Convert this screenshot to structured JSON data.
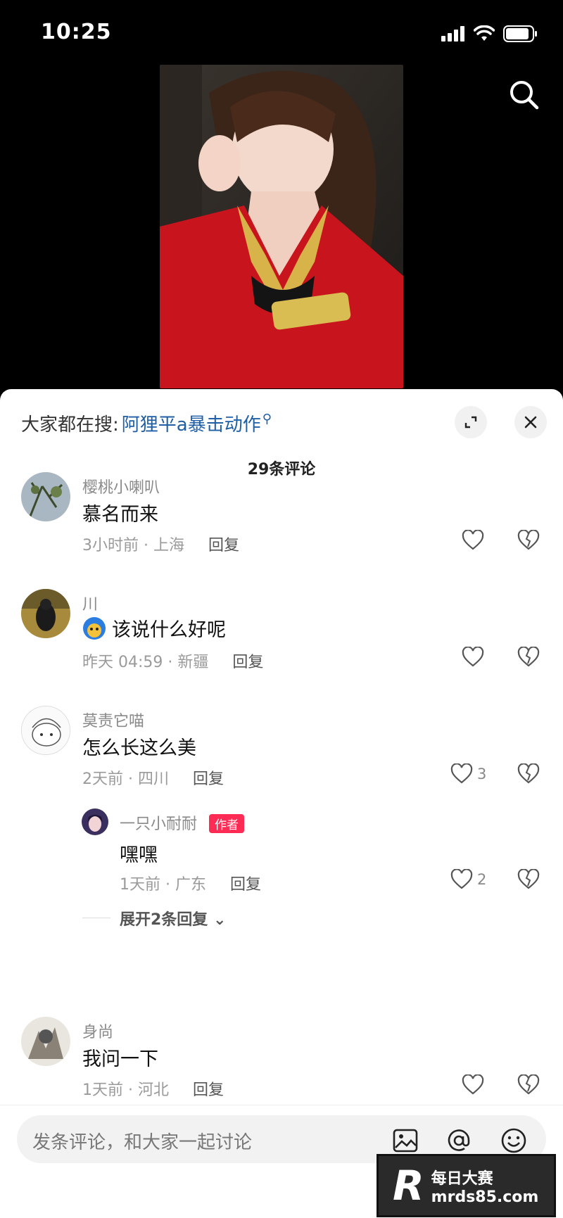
{
  "status": {
    "time": "10:25"
  },
  "sheet": {
    "suggest_prefix": "大家都在搜:",
    "suggest_query": "阿狸平a暴击动作",
    "comment_count": "29条评论"
  },
  "comments": [
    {
      "username": "樱桃小喇叭",
      "text": "慕名而来",
      "meta": "3小时前 · 上海",
      "reply": "回复",
      "likes": ""
    },
    {
      "username": "川",
      "text": "该说什么好呢",
      "meta": "昨天 04:59 · 新疆",
      "reply": "回复",
      "likes": ""
    },
    {
      "username": "莫责它喵",
      "text": "怎么长这么美",
      "meta": "2天前 · 四川",
      "reply": "回复",
      "likes": "3"
    },
    {
      "username": "身尚",
      "text": "我问一下",
      "meta": "1天前 · 河北",
      "reply": "回复",
      "likes": ""
    }
  ],
  "sub_reply": {
    "username": "一只小耐耐",
    "badge": "作者",
    "text": "嘿嘿",
    "meta": "1天前 · 广东",
    "reply": "回复",
    "likes": "2",
    "expand": "展开2条回复"
  },
  "input": {
    "placeholder": "发条评论，和大家一起讨论"
  },
  "watermark": {
    "title": "每日大赛",
    "url": "mrds85.com"
  },
  "colors": {
    "accent": "#fe2c55",
    "link": "#1f5fa6"
  }
}
